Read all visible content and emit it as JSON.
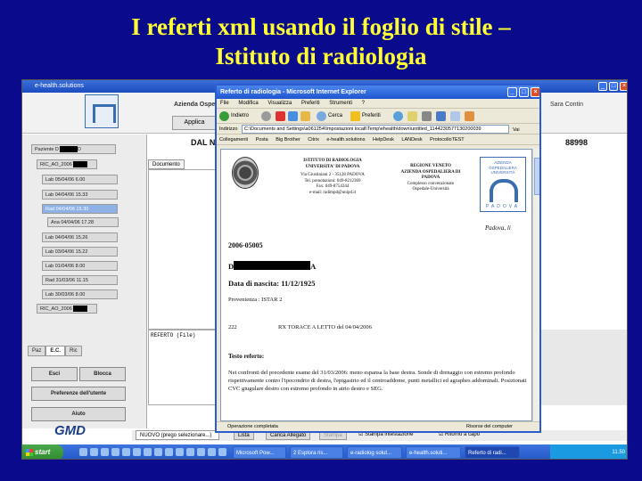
{
  "slide": {
    "title_line1": "I referti xml usando il foglio di stile –",
    "title_line2": "Istituto di radiologia"
  },
  "app": {
    "window_title": "e-health.solutions",
    "hospital": "Azienda Ospe",
    "user": "Sara Contin",
    "tab": "Applica",
    "patient_header": "DAL N",
    "record_code": "88998",
    "document_tab": "Documento",
    "referto_label": "REFERTO (File)",
    "sidebar_items": [
      {
        "label": "Paziente D",
        "suffix": "D",
        "redacted": true
      },
      {
        "label": "RIC_AO_2006",
        "redacted": true
      },
      {
        "label": "Lab 05/04/06 6.00"
      },
      {
        "label": "Lab 04/04/06 15.33"
      },
      {
        "label": "Rad  04/04/06 15.30",
        "selected": true
      },
      {
        "label": "Ana 04/04/06 17.28"
      },
      {
        "label": "Lab 04/04/06 15.26"
      },
      {
        "label": "Lab 03/04/06 15.22"
      },
      {
        "label": "Lab 01/04/06 8.00"
      },
      {
        "label": "Rad  31/03/06 11.15"
      },
      {
        "label": "Lab 30/03/06 8.00"
      },
      {
        "label": "RIC_AO_2006",
        "redacted": true
      }
    ],
    "left_tabs": [
      "Paz",
      "E.C.",
      "Ric"
    ],
    "buttons": {
      "esci": "Esci",
      "blocca": "Blocca",
      "preferenze": "Preferenze dell'utente",
      "aiuto": "Aiuto"
    },
    "logo": "GMD",
    "bottom": {
      "select": "NUOVO (prego selezionare...)",
      "lista": "Lista",
      "carica": "Carica Allegato",
      "stampa": "Stampa",
      "stampa_intestazione": "Stampa intestazione",
      "ritorno": "Ritorno a capo"
    }
  },
  "ie": {
    "title": "Referto di radiologia - Microsoft Internet Explorer",
    "menu": [
      "File",
      "Modifica",
      "Visualizza",
      "Preferiti",
      "Strumenti",
      "?"
    ],
    "toolbar": {
      "indietro": "Indietro",
      "cerca": "Cerca",
      "preferiti": "Preferiti"
    },
    "address_label": "Indirizzo",
    "address": "C:\\Documents and Settings\\a061254\\Impostazioni locali\\Temp\\ehealth\\down\\untitled_1144230577130200039",
    "go": "Vai",
    "links_label": "Collegamenti",
    "links": [
      "Posta",
      "Big Brother",
      "Citrix",
      "e-health.solutions",
      "HelpDesk",
      "LANDesk",
      "ProtocolloTEST"
    ],
    "status_left": "Operazione completata",
    "status_right": "Risorse del computer"
  },
  "report": {
    "inst_name": "ISTITUTO DI RADIOLOGIA",
    "inst_univ": "UNIVERSITA' DI PADOVA",
    "inst_addr": "Via Giustiniani 2 - 35128 PADOVA",
    "inst_tel": "Tel. prenotazioni: 049-8212369",
    "inst_fax": "Fax: 049-8754344",
    "inst_mail": "e-mail: radimpd@unipd.it",
    "region_1": "REGIONE VENETO",
    "region_2": "AZIENDA OSPEDALIERA DI",
    "region_3": "PADOVA",
    "region_4": "Complesso convenzionato",
    "region_5": "Ospedale-Università",
    "logo_top": "AZIENDA OSPEDALIERA UNIVERSITÀ",
    "logo_bottom": "PADOVA",
    "city_date": "Padova, li",
    "report_id": "2006-05005",
    "patient_initial": "D",
    "patient_suffix": "A",
    "dob": "Data di nascita: 11/12/1925",
    "provenienza": "Provenienza : ISTAR 2",
    "exam_code": "222",
    "exam_desc": "RX TORACE A LETTO del 04/04/2006",
    "testo_label": "Testo referto:",
    "testo": "Nei confronti del precedente esame del 31/03/2006: meno espansa la base destra. Sonde di drenaggio con estremo profondo rispettivamente contro l'ipocondrio di destra, l'epigastrio ed il centroaddome, punti metallici ed agraphes addominali. Posizionati CVC giugulare destro con estremo profondo in atrio destro e SEG."
  },
  "taskbar": {
    "start": "start",
    "items": [
      "Microsoft Pow...",
      "2 Esplora ris...",
      "e-radiolog solut...",
      "e-health.soluti...",
      "Referto di radi..."
    ],
    "clock": "11.50"
  }
}
